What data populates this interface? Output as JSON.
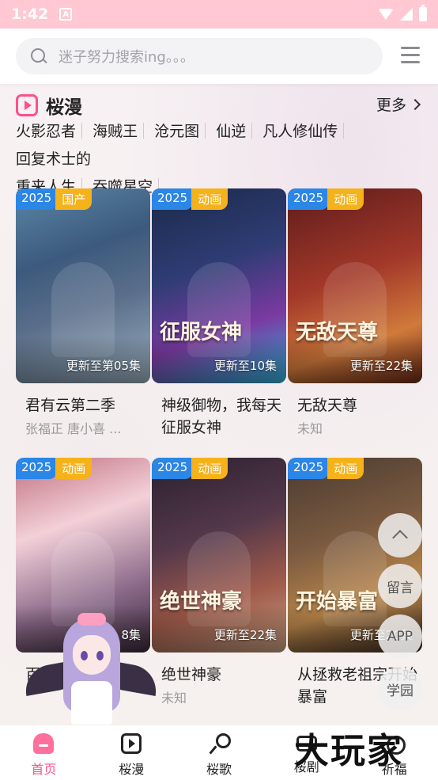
{
  "status": {
    "time": "1:42",
    "notif_glyph": "A"
  },
  "search": {
    "placeholder": "迷子努力搜索ing。。。"
  },
  "section": {
    "title": "桜漫",
    "more_label": "更多",
    "tags": [
      "火影忍者",
      "海贼王",
      "沧元图",
      "仙逆",
      "凡人修仙传",
      "回复术士的",
      "重来人生",
      "吞噬星空"
    ]
  },
  "cards": [
    {
      "year": "2025",
      "type": "国产",
      "update": "更新至第05集",
      "title": "君有云第二季",
      "cast": "张福正 唐小喜 ...",
      "art_text": ""
    },
    {
      "year": "2025",
      "type": "动画",
      "update": "更新至10集",
      "title": "神级御物，我每天征服女神",
      "cast": "",
      "art_text": "征服女神"
    },
    {
      "year": "2025",
      "type": "动画",
      "update": "更新至22集",
      "title": "无敌天尊",
      "cast": "未知",
      "art_text": "无敌天尊"
    },
    {
      "year": "2025",
      "type": "动画",
      "update": "8集",
      "title": "百妻",
      "cast": "",
      "art_text": ""
    },
    {
      "year": "2025",
      "type": "动画",
      "update": "更新至22集",
      "title": "绝世神豪",
      "cast": "未知",
      "art_text": "绝世神豪"
    },
    {
      "year": "2025",
      "type": "动画",
      "update": "更新至20集",
      "title": "从拯救老祖宗开始暴富",
      "cast": "",
      "art_text": "开始暴富"
    }
  ],
  "floating": {
    "message": "留言",
    "app": "APP",
    "school": "学园"
  },
  "watermark": "大玩家",
  "nav": {
    "items": [
      {
        "label": "首页",
        "icon": "home-icon"
      },
      {
        "label": "桜漫",
        "icon": "play-icon"
      },
      {
        "label": "桜歌",
        "icon": "mic-icon"
      },
      {
        "label": "桜剧",
        "icon": "tv-icon"
      },
      {
        "label": "祈福",
        "icon": "pray-icon"
      }
    ],
    "active_color": "#ff4f8b"
  },
  "colors": {
    "status_bar": "#ffc8d2",
    "accent": "#ff4f8b",
    "year_badge": "#2b86e6",
    "type_badge": "#f6b21b"
  }
}
